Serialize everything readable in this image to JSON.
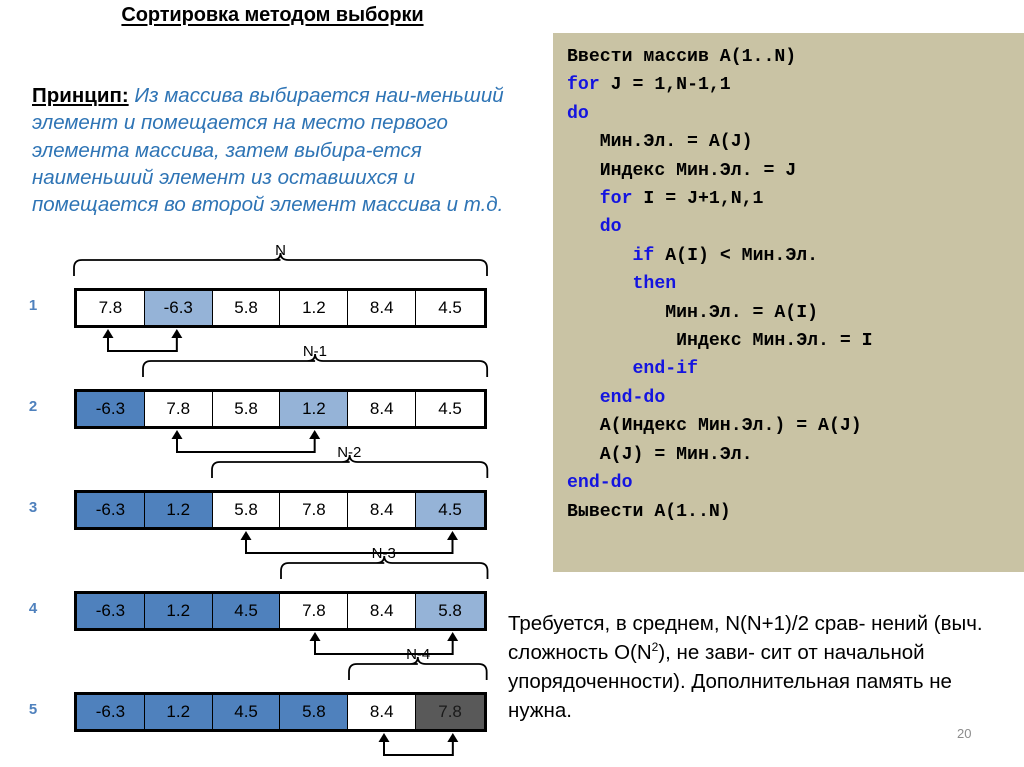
{
  "slide": {
    "title": "Сортировка методом выборки",
    "page_number": "20"
  },
  "principle": {
    "label": "Принцип:",
    "text": "Из массива выбирается наи-меньший элемент и помещается на место первого элемента массива, затем выбира-ется наименьший элемент из оставшихся и помещается во второй элемент массива и т.д."
  },
  "diagram": {
    "rows": [
      {
        "number": "1",
        "brace_label": "N",
        "brace_start": 0,
        "brace_end": 6,
        "cells": [
          {
            "value": "7.8",
            "state": "plain"
          },
          {
            "value": "-6.3",
            "state": "sel"
          },
          {
            "value": "5.8",
            "state": "plain"
          },
          {
            "value": "1.2",
            "state": "plain"
          },
          {
            "value": "8.4",
            "state": "plain"
          },
          {
            "value": "4.5",
            "state": "plain"
          }
        ],
        "swap": [
          0,
          1
        ]
      },
      {
        "number": "2",
        "brace_label": "N-1",
        "brace_start": 1,
        "brace_end": 6,
        "cells": [
          {
            "value": "-6.3",
            "state": "sorted"
          },
          {
            "value": "7.8",
            "state": "plain"
          },
          {
            "value": "5.8",
            "state": "plain"
          },
          {
            "value": "1.2",
            "state": "sel"
          },
          {
            "value": "8.4",
            "state": "plain"
          },
          {
            "value": "4.5",
            "state": "plain"
          }
        ],
        "swap": [
          1,
          3
        ]
      },
      {
        "number": "3",
        "brace_label": "N-2",
        "brace_start": 2,
        "brace_end": 6,
        "cells": [
          {
            "value": "-6.3",
            "state": "sorted"
          },
          {
            "value": "1.2",
            "state": "sorted"
          },
          {
            "value": "5.8",
            "state": "plain"
          },
          {
            "value": "7.8",
            "state": "plain"
          },
          {
            "value": "8.4",
            "state": "plain"
          },
          {
            "value": "4.5",
            "state": "sel"
          }
        ],
        "swap": [
          2,
          5
        ]
      },
      {
        "number": "4",
        "brace_label": "N-3",
        "brace_start": 3,
        "brace_end": 6,
        "cells": [
          {
            "value": "-6.3",
            "state": "sorted"
          },
          {
            "value": "1.2",
            "state": "sorted"
          },
          {
            "value": "4.5",
            "state": "sorted"
          },
          {
            "value": "7.8",
            "state": "plain"
          },
          {
            "value": "8.4",
            "state": "plain"
          },
          {
            "value": "5.8",
            "state": "sel"
          }
        ],
        "swap": [
          3,
          5
        ]
      },
      {
        "number": "5",
        "brace_label": "N-4",
        "brace_start": 4,
        "brace_end": 6,
        "cells": [
          {
            "value": "-6.3",
            "state": "sorted"
          },
          {
            "value": "1.2",
            "state": "sorted"
          },
          {
            "value": "4.5",
            "state": "sorted"
          },
          {
            "value": "5.8",
            "state": "sorted"
          },
          {
            "value": "8.4",
            "state": "plain"
          },
          {
            "value": "7.8",
            "state": "done"
          }
        ],
        "swap": [
          4,
          5
        ]
      }
    ],
    "colors": {
      "selected": "#95b3d7",
      "sorted": "#4f81bd",
      "done": "#595959",
      "row_number": "#4f81bd"
    }
  },
  "code": {
    "background": "#c9c3a4",
    "keyword_color": "#1414e0",
    "lines": [
      [
        {
          "t": "Ввести массив A(1..N)",
          "kw": false
        }
      ],
      [
        {
          "t": "for",
          "kw": true
        },
        {
          "t": " J = 1,N-1,1",
          "kw": false
        }
      ],
      [
        {
          "t": "do",
          "kw": true
        }
      ],
      [
        {
          "t": "   Мин.Эл. = A(J)",
          "kw": false
        }
      ],
      [
        {
          "t": "   Индекс Мин.Эл. = J",
          "kw": false
        }
      ],
      [
        {
          "t": "   ",
          "kw": false
        },
        {
          "t": "for",
          "kw": true
        },
        {
          "t": " I = J+1,N,1",
          "kw": false
        }
      ],
      [
        {
          "t": "   ",
          "kw": false
        },
        {
          "t": "do",
          "kw": true
        }
      ],
      [
        {
          "t": "      ",
          "kw": false
        },
        {
          "t": "if",
          "kw": true
        },
        {
          "t": " A(I) < Мин.Эл.",
          "kw": false
        }
      ],
      [
        {
          "t": "      ",
          "kw": false
        },
        {
          "t": "then",
          "kw": true
        }
      ],
      [
        {
          "t": "         Мин.Эл. = A(I)",
          "kw": false
        }
      ],
      [
        {
          "t": "          Индекс Мин.Эл. = I",
          "kw": false
        }
      ],
      [
        {
          "t": "      ",
          "kw": false
        },
        {
          "t": "end-if",
          "kw": true
        }
      ],
      [
        {
          "t": "   ",
          "kw": false
        },
        {
          "t": "end-do",
          "kw": true
        }
      ],
      [
        {
          "t": "   A(Индекс Мин.Эл.) = A(J)",
          "kw": false
        }
      ],
      [
        {
          "t": "   A(J) = Мин.Эл.",
          "kw": false
        }
      ],
      [
        {
          "t": "end-do",
          "kw": true
        }
      ],
      [
        {
          "t": "Вывести A(1..N)",
          "kw": false
        }
      ]
    ]
  },
  "note": {
    "line1_a": "Требуется, в среднем, N(N+1)/2 срав-",
    "line2_a": "нений (выч. сложность O(N",
    "line2_sup": "2",
    "line2_b": "), не зави-",
    "line3": "сит от начальной упорядоченности).",
    "line4": "Дополнительная память не нужна."
  }
}
